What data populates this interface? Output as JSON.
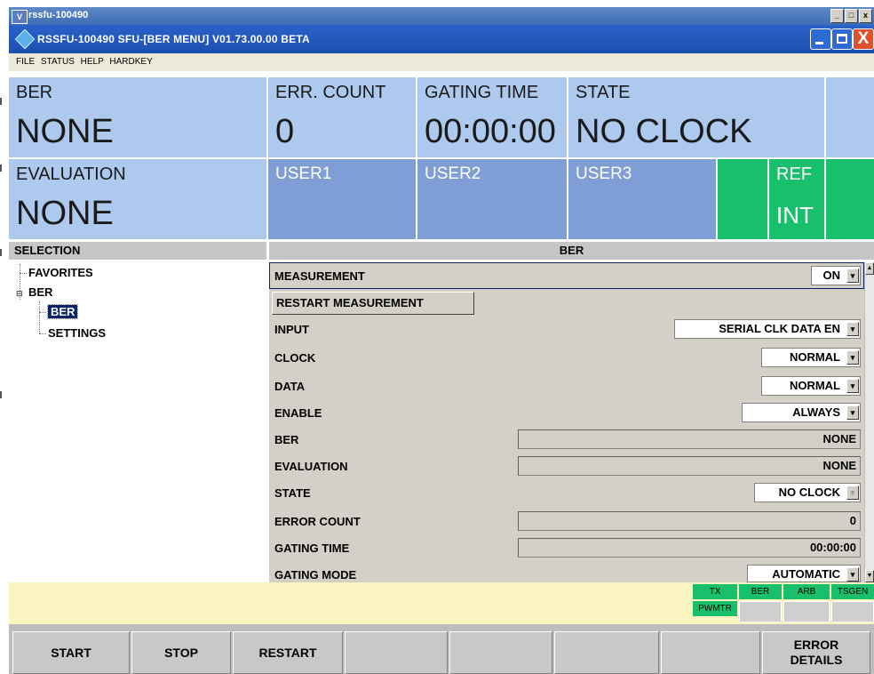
{
  "outer_window": {
    "title": "rssfu-100490",
    "logo": "V"
  },
  "window": {
    "title": "RSSFU-100490  SFU-[BER MENU]  V01.73.00.00 BETA",
    "close_glyph": "X"
  },
  "menu": [
    "FILE",
    "STATUS",
    "HELP",
    "HARDKEY"
  ],
  "status": {
    "ber_label": "BER",
    "ber_value": "NONE",
    "err_count_label": "ERR. COUNT",
    "err_count_value": "0",
    "gating_time_label": "GATING TIME",
    "gating_time_value": "00:00:00",
    "state_label": "STATE",
    "state_value": "NO CLOCK",
    "evaluation_label": "EVALUATION",
    "evaluation_value": "NONE",
    "user1": "USER1",
    "user2": "USER2",
    "user3": "USER3",
    "ref_label": "REF",
    "ref_value": "INT"
  },
  "selection": {
    "header": "SELECTION",
    "tree": [
      "FAVORITES",
      "BER",
      "BER",
      "SETTINGS"
    ],
    "selected": "BER"
  },
  "ber_panel": {
    "header": "BER",
    "measurement_label": "MEASUREMENT",
    "measurement_value": "ON",
    "restart_button": "RESTART MEASUREMENT",
    "input_label": "INPUT",
    "input_value": "SERIAL CLK DATA EN",
    "clock_label": "CLOCK",
    "clock_value": "NORMAL",
    "data_label": "DATA",
    "data_value": "NORMAL",
    "enable_label": "ENABLE",
    "enable_value": "ALWAYS",
    "ber_label": "BER",
    "ber_value": "NONE",
    "evaluation_label": "EVALUATION",
    "evaluation_value": "NONE",
    "state_label": "STATE",
    "state_value": "NO CLOCK",
    "error_count_label": "ERROR COUNT",
    "error_count_value": "0",
    "gating_time_label": "GATING TIME",
    "gating_time_value": "00:00:00",
    "gating_mode_label": "GATING MODE",
    "gating_mode_value": "AUTOMATIC"
  },
  "indicators": [
    "TX",
    "BER",
    "ARB",
    "TSGEN",
    "PWMTR"
  ],
  "softkeys": {
    "start": "START",
    "stop": "STOP",
    "restart": "RESTART",
    "error_line1": "ERROR",
    "error_line2": "DETAILS"
  },
  "colors": {
    "status_blue": "#aec9ee",
    "user_blue": "#7f9ed6",
    "green": "#19c06c",
    "selection": "#0a246a",
    "yellow_bar": "#fbf4c0"
  }
}
